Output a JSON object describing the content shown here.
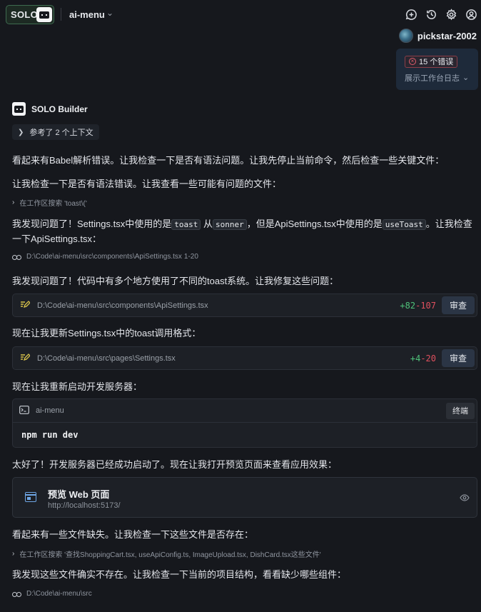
{
  "topbar": {
    "solo_label": "SOLO",
    "project": "ai-menu",
    "icons": [
      "add-chat-icon",
      "history-icon",
      "gear-icon",
      "account-icon"
    ]
  },
  "user": {
    "name": "pickstar-2002"
  },
  "errors": {
    "count_label": "15 个错误",
    "toggle_label": "展示工作台日志"
  },
  "builder": {
    "name": "SOLO Builder",
    "ref_label": "参考了 2 个上下文"
  },
  "messages": {
    "m1": "看起来有Babel解析错误。让我检查一下是否有语法问题。让我先停止当前命令，然后检查一些关键文件：",
    "m2": "让我检查一下是否有语法错误。让我查看一些可能有问题的文件：",
    "search1": "在工作区搜索 'toast\\('",
    "m3": {
      "part1": "我发现问题了！Settings.tsx中使用的是",
      "code1": "toast",
      "part2": "从",
      "code2": "sonner",
      "part3": "，但是ApiSettings.tsx中使用的是",
      "code3": "useToast",
      "part4": "。让我检查一下ApiSettings.tsx："
    },
    "read1": {
      "path": "D:\\Code\\ai-menu\\src\\components\\ApiSettings.tsx",
      "range": "1-20"
    },
    "m4": "我发现问题了！代码中有多个地方使用了不同的toast系统。让我修复这些问题：",
    "edit1": {
      "path": "D:\\Code\\ai-menu\\src\\components\\ApiSettings.tsx",
      "added": "+82",
      "removed": "-107",
      "button": "审查"
    },
    "m5": "现在让我更新Settings.tsx中的toast调用格式：",
    "edit2": {
      "path": "D:\\Code\\ai-menu\\src\\pages\\Settings.tsx",
      "added": "+4",
      "removed": "-20",
      "button": "审查"
    },
    "m6": "现在让我重新启动开发服务器：",
    "terminal": {
      "name": "ai-menu",
      "button": "终端",
      "command": "npm run dev"
    },
    "m7": "太好了！开发服务器已经成功启动了。现在让我打开预览页面来查看应用效果：",
    "preview": {
      "title": "预览 Web 页面",
      "url": "http://localhost:5173/"
    },
    "m8": "看起来有一些文件缺失。让我检查一下这些文件是否存在：",
    "search2": "在工作区搜索 '查找ShoppingCart.tsx, useApiConfig.ts, ImageUpload.tsx, DishCard.tsx这些文件'",
    "m9": "我发现这些文件确实不存在。让我检查一下当前的项目结构，看看缺少哪些组件：",
    "read2": {
      "path": "D:\\Code\\ai-menu\\src"
    }
  },
  "colors": {
    "added": "#4fc27a",
    "removed": "#e0505e",
    "error": "#e25d6b",
    "accent": "#6fa7e6"
  }
}
